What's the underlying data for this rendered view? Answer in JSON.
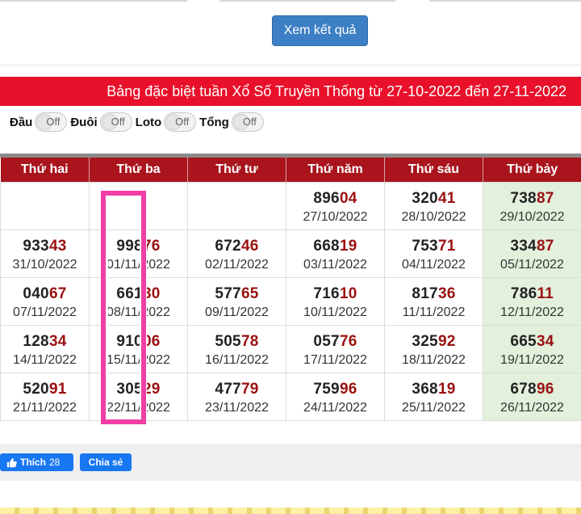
{
  "form": {
    "submit_label": "Xem kết quả"
  },
  "banner": {
    "title": "Bảng đặc biệt tuần Xổ Số Truyền Thống từ 27-10-2022 đến 27-11-2022"
  },
  "toggles": [
    {
      "label": "Đầu",
      "state": "Off"
    },
    {
      "label": "Đuôi",
      "state": "Off"
    },
    {
      "label": "Loto",
      "state": "Off"
    },
    {
      "label": "Tổng",
      "state": "Off"
    }
  ],
  "table": {
    "headers": [
      "Thứ hai",
      "Thứ ba",
      "Thứ tư",
      "Thứ năm",
      "Thứ sáu",
      "Thứ bảy"
    ],
    "rows": [
      [
        {
          "head": "",
          "tail": "",
          "date": ""
        },
        {
          "head": "",
          "tail": "",
          "date": ""
        },
        {
          "head": "",
          "tail": "",
          "date": ""
        },
        {
          "head": "896",
          "tail": "04",
          "date": "27/10/2022"
        },
        {
          "head": "320",
          "tail": "41",
          "date": "28/10/2022"
        },
        {
          "head": "738",
          "tail": "87",
          "date": "29/10/2022"
        }
      ],
      [
        {
          "head": "933",
          "tail": "43",
          "date": "31/10/2022"
        },
        {
          "head": "998",
          "tail": "76",
          "date": "01/11/2022"
        },
        {
          "head": "672",
          "tail": "46",
          "date": "02/11/2022"
        },
        {
          "head": "668",
          "tail": "19",
          "date": "03/11/2022"
        },
        {
          "head": "753",
          "tail": "71",
          "date": "04/11/2022"
        },
        {
          "head": "334",
          "tail": "87",
          "date": "05/11/2022"
        }
      ],
      [
        {
          "head": "040",
          "tail": "67",
          "date": "07/11/2022"
        },
        {
          "head": "661",
          "tail": "30",
          "date": "08/11/2022"
        },
        {
          "head": "577",
          "tail": "65",
          "date": "09/11/2022"
        },
        {
          "head": "716",
          "tail": "10",
          "date": "10/11/2022"
        },
        {
          "head": "817",
          "tail": "36",
          "date": "11/11/2022"
        },
        {
          "head": "786",
          "tail": "11",
          "date": "12/11/2022"
        }
      ],
      [
        {
          "head": "128",
          "tail": "34",
          "date": "14/11/2022"
        },
        {
          "head": "910",
          "tail": "06",
          "date": "15/11/2022"
        },
        {
          "head": "505",
          "tail": "78",
          "date": "16/11/2022"
        },
        {
          "head": "057",
          "tail": "76",
          "date": "17/11/2022"
        },
        {
          "head": "325",
          "tail": "92",
          "date": "18/11/2022"
        },
        {
          "head": "665",
          "tail": "34",
          "date": "19/11/2022"
        }
      ],
      [
        {
          "head": "520",
          "tail": "91",
          "date": "21/11/2022"
        },
        {
          "head": "305",
          "tail": "29",
          "date": "22/11/2022"
        },
        {
          "head": "477",
          "tail": "79",
          "date": "23/11/2022"
        },
        {
          "head": "759",
          "tail": "96",
          "date": "24/11/2022"
        },
        {
          "head": "368",
          "tail": "19",
          "date": "25/11/2022"
        },
        {
          "head": "678",
          "tail": "96",
          "date": "26/11/2022"
        }
      ]
    ]
  },
  "social": {
    "like_label": "Thích",
    "like_count": "28",
    "share_label": "Chia sẻ"
  },
  "colors": {
    "banner": "#e8102a",
    "header": "#a9141d",
    "accent_number": "#9a1010",
    "saturday_bg": "#e2f0dc",
    "highlight": "#ef3fa6",
    "button": "#3d7fc4"
  }
}
